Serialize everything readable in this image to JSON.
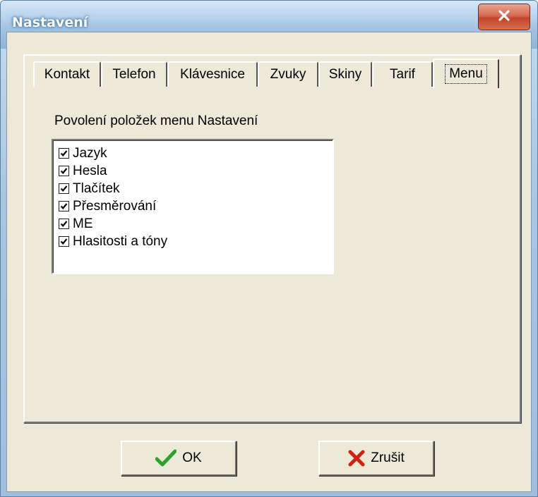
{
  "window": {
    "title": "Nastavení",
    "close_icon": "close-icon"
  },
  "tabs": [
    {
      "label": "Kontakt",
      "active": false
    },
    {
      "label": "Telefon",
      "active": false
    },
    {
      "label": "Klávesnice",
      "active": false
    },
    {
      "label": "Zvuky",
      "active": false
    },
    {
      "label": "Skiny",
      "active": false
    },
    {
      "label": "Tarif",
      "active": false
    },
    {
      "label": "Menu",
      "active": true
    }
  ],
  "menu_tab": {
    "group_label": "Povolení položek menu Nastavení",
    "items": [
      {
        "label": "Jazyk",
        "checked": true
      },
      {
        "label": "Hesla",
        "checked": true
      },
      {
        "label": "Tlačítek",
        "checked": true
      },
      {
        "label": "Přesměrování",
        "checked": true
      },
      {
        "label": "ME",
        "checked": true
      },
      {
        "label": "Hlasitosti a tóny",
        "checked": true
      }
    ]
  },
  "buttons": {
    "ok": {
      "label": "OK",
      "icon": "checkmark-icon",
      "icon_color": "#2ea02e"
    },
    "cancel": {
      "label": "Zrušit",
      "icon": "cross-icon",
      "icon_color": "#d02010"
    }
  }
}
